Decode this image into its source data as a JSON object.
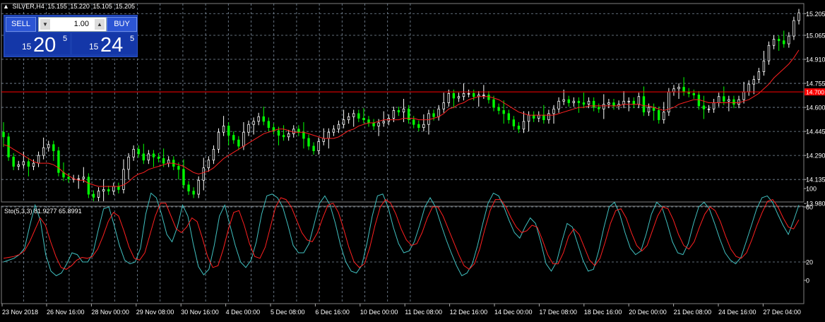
{
  "header": {
    "symbol": "SILVER,H4",
    "open": "15.155",
    "high": "15.220",
    "low": "15.105",
    "close": "15.205"
  },
  "trade_panel": {
    "sell_label": "SELL",
    "buy_label": "BUY",
    "lot_value": "1.00",
    "sell_prefix": "15",
    "sell_big": "20",
    "sell_sup": "5",
    "buy_prefix": "15",
    "buy_big": "24",
    "buy_sup": "5"
  },
  "indicator": {
    "label": "Sto(5,3,3) 81.9277 65.8991"
  },
  "price_marker": "14.700",
  "colors": {
    "background": "#000000",
    "bull_candle": "#ffffff",
    "bear_candle": "#00ff00",
    "moving_average": "#ff2020",
    "stoch_main": "#40c0c0",
    "stoch_signal": "#ff2020",
    "grid": "#7f8fa0",
    "marker": "#ff0000"
  },
  "chart_data": [
    {
      "type": "candlestick",
      "ylim": [
        13.99,
        15.27
      ],
      "yticks": [
        "15.205",
        "15.065",
        "14.910",
        "14.755",
        "14.600",
        "14.445",
        "14.290",
        "14.135",
        "13.980"
      ],
      "xticks": [
        "23 Nov 2018",
        "26 Nov 16:00",
        "28 Nov 00:00",
        "29 Nov 08:00",
        "30 Nov 16:00",
        "4 Dec 00:00",
        "5 Dec 08:00",
        "6 Dec 16:00",
        "10 Dec 00:00",
        "11 Dec 08:00",
        "12 Dec 16:00",
        "14 Dec 00:00",
        "17 Dec 08:00",
        "18 Dec 16:00",
        "20 Dec 00:00",
        "21 Dec 08:00",
        "24 Dec 16:00",
        "27 Dec 04:00"
      ],
      "horizontal_line": 14.7,
      "close": [
        14.41,
        14.28,
        14.22,
        14.23,
        14.25,
        14.22,
        14.24,
        14.29,
        14.34,
        14.36,
        14.32,
        14.18,
        14.15,
        14.14,
        14.14,
        14.14,
        14.15,
        14.04,
        14.02,
        14.06,
        14.07,
        14.06,
        14.09,
        14.07,
        14.2,
        14.28,
        14.33,
        14.3,
        14.26,
        14.3,
        14.28,
        14.27,
        14.24,
        14.26,
        14.22,
        14.2,
        14.1,
        14.06,
        14.04,
        14.13,
        14.21,
        14.26,
        14.33,
        14.44,
        14.48,
        14.42,
        14.39,
        14.35,
        14.44,
        14.49,
        14.51,
        14.54,
        14.51,
        14.47,
        14.45,
        14.42,
        14.41,
        14.43,
        14.46,
        14.44,
        14.4,
        14.35,
        14.32,
        14.38,
        14.4,
        14.44,
        14.46,
        14.49,
        14.52,
        14.54,
        14.56,
        14.53,
        14.52,
        14.5,
        14.48,
        14.5,
        14.51,
        14.53,
        14.58,
        14.57,
        14.59,
        14.52,
        14.49,
        14.47,
        14.49,
        14.56,
        14.54,
        14.59,
        14.63,
        14.69,
        14.66,
        14.67,
        14.69,
        14.69,
        14.67,
        14.68,
        14.68,
        14.65,
        14.6,
        14.58,
        14.56,
        14.52,
        14.48,
        14.46,
        14.51,
        14.55,
        14.53,
        14.55,
        14.52,
        14.56,
        14.59,
        14.64,
        14.65,
        14.63,
        14.64,
        14.63,
        14.62,
        14.64,
        14.6,
        14.59,
        14.62,
        14.63,
        14.61,
        14.62,
        14.64,
        14.64,
        14.62,
        14.67,
        14.57,
        14.6,
        14.58,
        14.52,
        14.57,
        14.7,
        14.72,
        14.73,
        14.7,
        14.69,
        14.68,
        14.61,
        14.59,
        14.59,
        14.63,
        14.67,
        14.64,
        14.65,
        14.62,
        14.65,
        14.7,
        14.75,
        14.78,
        14.83,
        14.9,
        15.0,
        15.04,
        15.03,
        15.01,
        15.06,
        15.16,
        15.21
      ],
      "series": [
        {
          "name": "MA",
          "values": [
            14.36,
            14.35,
            14.33,
            14.31,
            14.29,
            14.27,
            14.25,
            14.24,
            14.24,
            14.24,
            14.23,
            14.21,
            14.18,
            14.16,
            14.14,
            14.13,
            14.13,
            14.11,
            14.1,
            14.09,
            14.09,
            14.09,
            14.09,
            14.09,
            14.1,
            14.12,
            14.15,
            14.17,
            14.18,
            14.2,
            14.21,
            14.22,
            14.23,
            14.24,
            14.24,
            14.23,
            14.22,
            14.2,
            14.18,
            14.17,
            14.18,
            14.19,
            14.21,
            14.24,
            14.27,
            14.29,
            14.31,
            14.33,
            14.35,
            14.37,
            14.39,
            14.41,
            14.43,
            14.44,
            14.45,
            14.46,
            14.46,
            14.45,
            14.44,
            14.44,
            14.44,
            14.43,
            14.42,
            14.41,
            14.4,
            14.4,
            14.4,
            14.41,
            14.43,
            14.45,
            14.46,
            14.48,
            14.49,
            14.5,
            14.5,
            14.51,
            14.52,
            14.52,
            14.52,
            14.52,
            14.53,
            14.53,
            14.53,
            14.52,
            14.52,
            14.52,
            14.53,
            14.54,
            14.56,
            14.59,
            14.6,
            14.62,
            14.63,
            14.65,
            14.66,
            14.67,
            14.67,
            14.67,
            14.66,
            14.65,
            14.63,
            14.61,
            14.59,
            14.57,
            14.56,
            14.55,
            14.55,
            14.55,
            14.55,
            14.55,
            14.55,
            14.56,
            14.57,
            14.58,
            14.59,
            14.6,
            14.6,
            14.61,
            14.61,
            14.61,
            14.61,
            14.61,
            14.61,
            14.61,
            14.62,
            14.62,
            14.62,
            14.62,
            14.61,
            14.61,
            14.6,
            14.59,
            14.58,
            14.59,
            14.6,
            14.62,
            14.63,
            14.64,
            14.65,
            14.65,
            14.64,
            14.63,
            14.63,
            14.63,
            14.63,
            14.63,
            14.63,
            14.63,
            14.64,
            14.65,
            14.67,
            14.69,
            14.72,
            14.75,
            14.79,
            14.82,
            14.85,
            14.88,
            14.92,
            14.97
          ]
        }
      ]
    },
    {
      "type": "line",
      "ylim": [
        0,
        100
      ],
      "yticks": [
        "100",
        "80",
        "20",
        "0"
      ],
      "series": [
        {
          "name": "",
          "values": [
            20,
            22,
            24,
            28,
            35,
            60,
            82,
            65,
            28,
            10,
            5,
            8,
            18,
            30,
            28,
            20,
            20,
            30,
            55,
            78,
            80,
            60,
            38,
            22,
            18,
            20,
            35,
            72,
            95,
            90,
            72,
            50,
            42,
            58,
            82,
            70,
            40,
            15,
            6,
            12,
            38,
            70,
            82,
            60,
            38,
            20,
            14,
            22,
            42,
            72,
            92,
            94,
            90,
            80,
            60,
            38,
            30,
            30,
            40,
            62,
            84,
            92,
            82,
            62,
            38,
            20,
            10,
            8,
            16,
            40,
            70,
            92,
            94,
            80,
            58,
            40,
            30,
            32,
            42,
            60,
            80,
            90,
            80,
            62,
            45,
            30,
            16,
            5,
            8,
            18,
            38,
            62,
            84,
            95,
            92,
            80,
            65,
            52,
            46,
            58,
            68,
            62,
            42,
            18,
            10,
            20,
            42,
            62,
            58,
            40,
            22,
            10,
            12,
            32,
            58,
            80,
            85,
            72,
            52,
            35,
            28,
            32,
            50,
            72,
            85,
            80,
            62,
            42,
            30,
            28,
            40,
            62,
            80,
            85,
            78,
            62,
            45,
            30,
            22,
            18,
            25,
            42,
            60,
            78,
            90,
            92,
            85,
            72,
            60,
            50,
            65,
            82
          ]
        },
        {
          "name": "",
          "values": [
            24,
            25,
            26,
            28,
            32,
            42,
            55,
            68,
            60,
            42,
            26,
            14,
            12,
            16,
            22,
            25,
            24,
            26,
            34,
            48,
            64,
            74,
            70,
            54,
            36,
            24,
            22,
            30,
            50,
            70,
            84,
            84,
            70,
            56,
            52,
            58,
            68,
            64,
            46,
            26,
            14,
            16,
            34,
            56,
            74,
            76,
            60,
            40,
            26,
            24,
            36,
            58,
            80,
            90,
            88,
            80,
            66,
            52,
            44,
            42,
            52,
            68,
            82,
            84,
            74,
            56,
            36,
            20,
            14,
            18,
            36,
            60,
            80,
            88,
            84,
            72,
            56,
            44,
            38,
            40,
            52,
            68,
            80,
            80,
            70,
            56,
            42,
            28,
            16,
            12,
            18,
            34,
            56,
            76,
            88,
            88,
            80,
            68,
            58,
            52,
            54,
            60,
            58,
            44,
            28,
            18,
            18,
            30,
            48,
            56,
            50,
            36,
            22,
            16,
            24,
            42,
            62,
            76,
            78,
            68,
            52,
            38,
            32,
            38,
            54,
            70,
            80,
            78,
            66,
            50,
            38,
            34,
            42,
            58,
            72,
            80,
            76,
            64,
            48,
            34,
            26,
            24,
            30,
            44,
            60,
            74,
            86,
            88,
            80,
            68,
            58,
            56,
            66
          ]
        }
      ]
    }
  ]
}
